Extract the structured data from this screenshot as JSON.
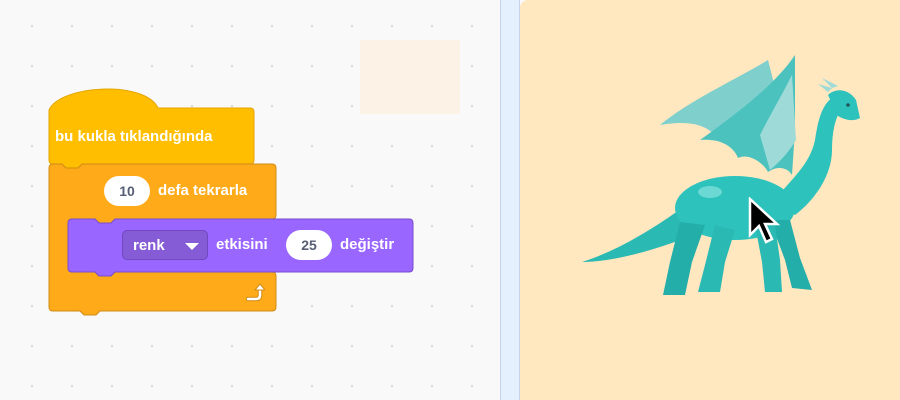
{
  "script": {
    "hat_label": "bu kukla tıklandığında",
    "repeat": {
      "count": "10",
      "label": "defa tekrarla"
    },
    "effect": {
      "effect_name": "renk",
      "label_mid": "etkisini",
      "amount": "25",
      "label_end": "değiştir"
    }
  },
  "colors": {
    "events": "#ffbf00",
    "control": "#ffab19",
    "looks": "#9966ff",
    "stage_bg": "#ffe7c0"
  },
  "icons": {
    "loop_arrow": "loop-arrow-icon",
    "dropdown": "caret-down-icon",
    "cursor": "mouse-pointer-icon"
  },
  "stage": {
    "sprite": "dragon"
  }
}
